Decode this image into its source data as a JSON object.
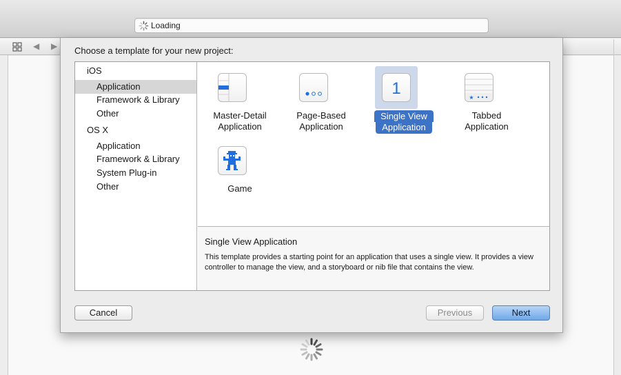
{
  "toolbar": {
    "activity_text": "Loading",
    "back_glyph": "◀",
    "forward_glyph": "▶"
  },
  "sheet": {
    "title": "Choose a template for your new project:"
  },
  "sidebar": {
    "groups": [
      {
        "label": "iOS",
        "items": [
          "Application",
          "Framework & Library",
          "Other"
        ]
      },
      {
        "label": "OS X",
        "items": [
          "Application",
          "Framework & Library",
          "System Plug-in",
          "Other"
        ]
      }
    ],
    "selected": "iOS / Application"
  },
  "templates": [
    {
      "line1": "Master-Detail",
      "line2": "Application",
      "icon": "master-detail-icon",
      "selected": false
    },
    {
      "line1": "Page-Based",
      "line2": "Application",
      "icon": "page-based-icon",
      "selected": false
    },
    {
      "line1": "Single View",
      "line2": "Application",
      "icon": "single-view-icon",
      "icon_text": "1",
      "selected": true
    },
    {
      "line1": "Tabbed",
      "line2": "Application",
      "icon": "tabbed-icon",
      "selected": false
    },
    {
      "line1": "Game",
      "line2": "",
      "icon": "game-icon",
      "selected": false
    }
  ],
  "description": {
    "title": "Single View Application",
    "text": "This template provides a starting point for an application that uses a single view. It provides a view controller to manage the view, and a storyboard or nib file that contains the view."
  },
  "buttons": {
    "cancel": "Cancel",
    "previous": "Previous",
    "next": "Next"
  },
  "colors": {
    "selection_blue": "#3d73c6",
    "selection_highlight": "#cdd8ea",
    "icon_blue": "#1f6fe0",
    "next_button": "#6ea8e8"
  }
}
